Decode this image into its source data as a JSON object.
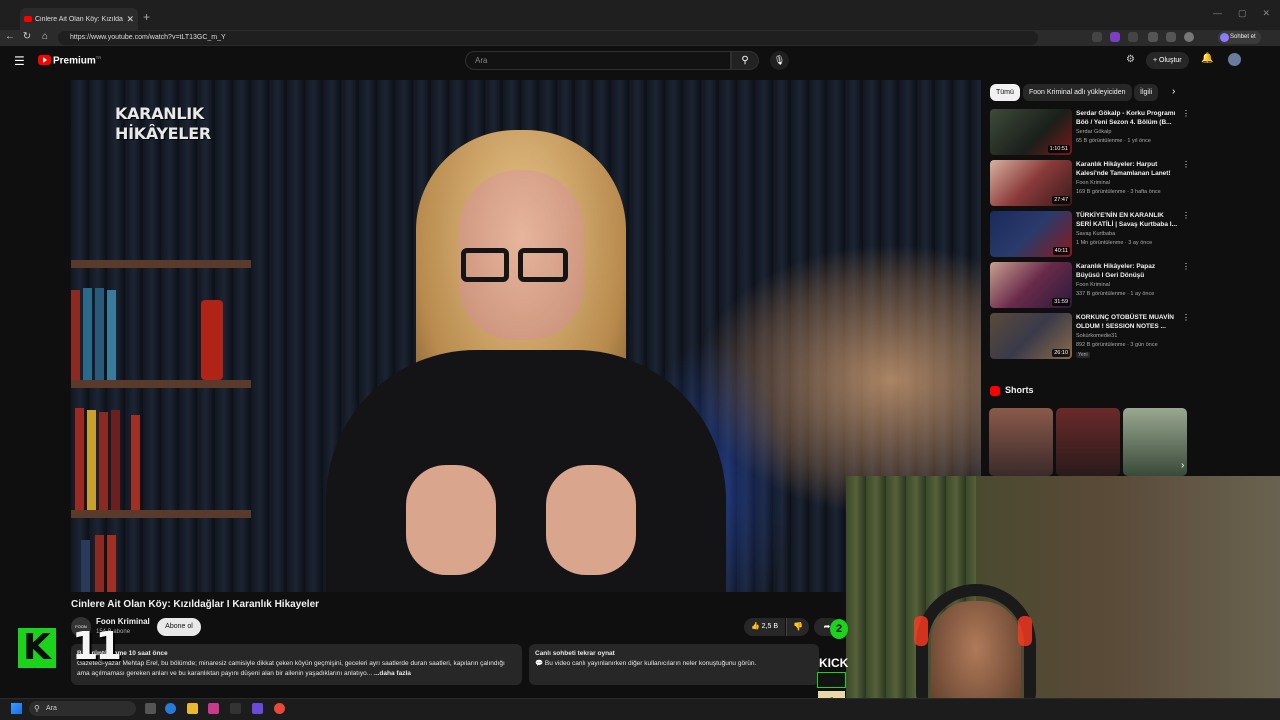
{
  "browser": {
    "tab_title": "Cinlere Ait Olan Köy: Kızıldağ...",
    "tab_close": "✕",
    "new_tab": "+",
    "url": "https://www.youtube.com/watch?v=tLT13GC_m_Y",
    "copilot_label": "Sohbet et",
    "window_controls": [
      "—",
      "▢",
      "✕"
    ]
  },
  "youtube": {
    "logo_text": "Premium",
    "logo_sup": "TR",
    "search_placeholder": "Ara",
    "create_label": "Oluştur"
  },
  "video": {
    "overlay_logo_line1": "KARANLIK",
    "overlay_logo_line2": "HİKÂYELER",
    "title": "Cinlere Ait Olan Köy: Kızıldağlar I Karanlık Hikayeler",
    "channel_name": "Foon Kriminal",
    "channel_avatar_text": "FOON",
    "subscribers": "154 B abone",
    "subscribe_label": "Abone ol",
    "likes": "2,5 B",
    "description_meta": "B görüntülenme  10 saat önce",
    "description_text": "Gazeteci-yazar Mehtap Erel, bu bölümde; minaresiz camisiyle dikkat çeken köyün geçmişini, geceleri ayrı saatlerde duran saatleri, kapıların çalındığı ama açılmaması gereken anları ve bu karanlıktan payını düşeni alan bir ailenin yaşadıklarını anlatıyo...",
    "description_more": "...daha fazla",
    "livechat_title": "Canlı sohbeti tekrar oynat",
    "livechat_text": "Bu video canlı yayınlanırken diğer kullanıcıların neler konuştuğunu görün."
  },
  "sidebar": {
    "chips": [
      "Tümü",
      "Foon Kriminal adlı yükleyiciden",
      "İlgili"
    ],
    "recommendations": [
      {
        "title": "Serdar Gökalp - Korku Programı Böö / Yeni Sezon 4. Bölüm (B...",
        "channel": "Serdar Gökalp",
        "meta": "65 B görüntülenme · 1 yıl önce",
        "duration": "1:10:51",
        "color": "#3e4a3a"
      },
      {
        "title": "Karanlık Hikâyeler: Harput Kalesi'nde Tamamlanan Lanet!",
        "channel": "Foon Kriminal",
        "meta": "169 B görüntülenme · 3 hafta önce",
        "duration": "27:47",
        "color": "#8a3a3a"
      },
      {
        "title": "TÜRKİYE'NİN EN KARANLIK SERİ KATİLİ | Savaş Kurtbaba I...",
        "channel": "Savaş Kurtbaba",
        "meta": "1 Mn görüntülenme · 3 ay önce",
        "duration": "40:11",
        "color": "#2a3a6a"
      },
      {
        "title": "Karanlık Hikâyeler: Papaz Büyüsü I Geri Dönüşü Olmayan...",
        "channel": "Foon Kriminal",
        "meta": "337 B görüntülenme · 1 ay önce",
        "duration": "31:59",
        "color": "#6a2a4a"
      },
      {
        "title": "KORKUNÇ OTOBÜSTE MUAVİN OLDUM ! SESSION NOTES ...",
        "channel": "Sokürkomedie31",
        "meta": "892 B görüntülenme · 3 gün önce",
        "duration": "26:10",
        "color": "#5a4a3a",
        "badge": "Yeni"
      }
    ],
    "shorts_label": "Shorts"
  },
  "stream_overlay": {
    "kick_letter": "K",
    "counter": "11",
    "kick_text": "KICK",
    "rank": "1",
    "circle_number": "2"
  },
  "taskbar": {
    "search_placeholder": "Ara"
  }
}
